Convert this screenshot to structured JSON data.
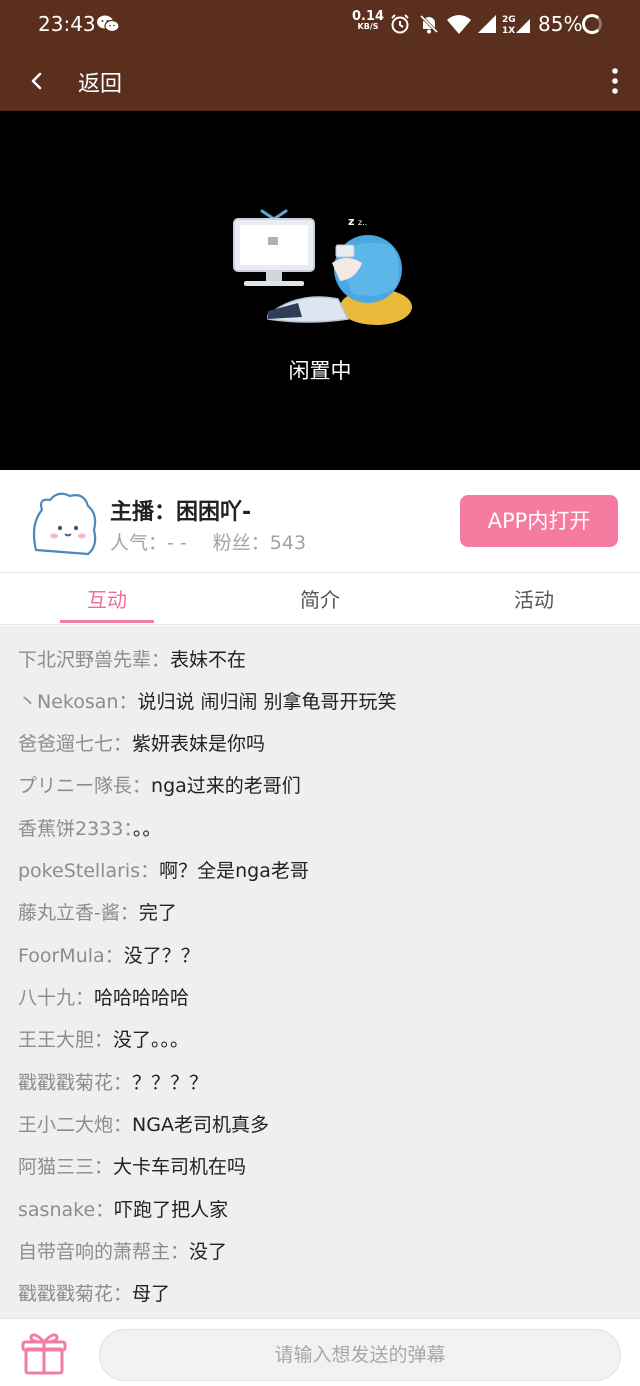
{
  "status_bar": {
    "time": "23:43",
    "net_speed_value": "0.14",
    "net_speed_unit": "KB/S",
    "battery": "85%",
    "icons": [
      "wechat-icon",
      "alarm-icon",
      "mute-icon",
      "wifi-icon",
      "signal-icon",
      "signal-2g-icon",
      "battery-icon"
    ]
  },
  "header": {
    "back_label": "返回"
  },
  "video": {
    "status_text": "闲置中"
  },
  "anchor": {
    "name": "主播：困困吖-",
    "popularity": "人气：- -",
    "fans": "粉丝：543",
    "open_app_button": "APP内打开"
  },
  "tabs": [
    {
      "label": "互动",
      "active": true
    },
    {
      "label": "简介",
      "active": false
    },
    {
      "label": "活动",
      "active": false
    }
  ],
  "chat": {
    "messages": [
      {
        "user": "下北沢野兽先辈",
        "text": "表妹不在"
      },
      {
        "user": "丶Nekosan",
        "text": "说归说 闹归闹 别拿龟哥开玩笑"
      },
      {
        "user": "爸爸遛七七",
        "text": "紫妍表妹是你吗"
      },
      {
        "user": "プリニー隊長",
        "text": "nga过来的老哥们"
      },
      {
        "user": "香蕉饼2333",
        "text": "。。"
      },
      {
        "user": "pokeStellaris",
        "text": "啊？全是nga老哥"
      },
      {
        "user": "藤丸立香-酱",
        "text": "完了"
      },
      {
        "user": "FoorMula",
        "text": "没了？？"
      },
      {
        "user": "八十九",
        "text": "哈哈哈哈哈"
      },
      {
        "user": "王王大胆",
        "text": "没了。。。"
      },
      {
        "user": "戳戳戳菊花",
        "text": "？？？？"
      },
      {
        "user": "王小二大炮",
        "text": "NGA老司机真多"
      },
      {
        "user": "阿猫三三",
        "text": "大卡车司机在吗"
      },
      {
        "user": "sasnake",
        "text": "吓跑了把人家"
      },
      {
        "user": "自带音响的萧帮主",
        "text": "没了"
      },
      {
        "user": "戳戳戳菊花",
        "text": "母了"
      }
    ],
    "separator": "："
  },
  "input": {
    "placeholder": "请输入想发送的弹幕"
  },
  "colors": {
    "header_bg": "#5a2f1d",
    "accent_pink": "#f67ba1",
    "chat_bg": "#efefef"
  }
}
